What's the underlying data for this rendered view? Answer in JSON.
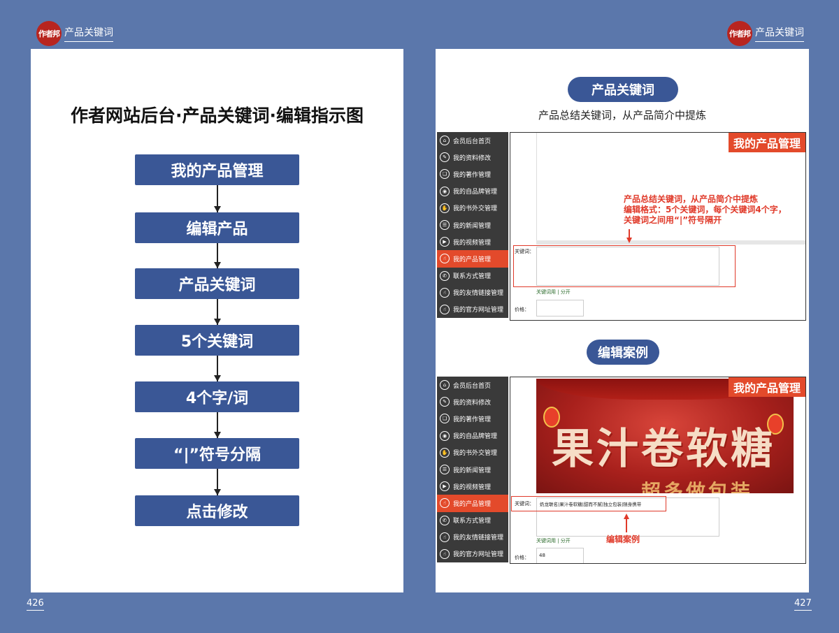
{
  "header": {
    "logo_text": "作者邦",
    "section_title": "产品关键词"
  },
  "left_page": {
    "number": "426",
    "title": "作者网站后台·产品关键词·编辑指示图",
    "flow_steps": [
      "我的产品管理",
      "编辑产品",
      "产品关键词",
      "5个关键词",
      "4个字/词",
      "“|”符号分隔",
      "点击修改"
    ]
  },
  "right_page": {
    "number": "427",
    "section1_pill": "产品关键词",
    "section1_subtitle": "产品总结关键词，从产品简介中提炼",
    "section2_pill": "编辑案例",
    "sidebar_items": [
      "会员后台首页",
      "我的资料修改",
      "我的著作管理",
      "我的自品牌管理",
      "我的书外交管理",
      "我的新闻管理",
      "我的视频管理",
      "我的产品管理",
      "联系方式管理",
      "我的友情链接管理",
      "我的官方网址管理"
    ],
    "sidebar_active": "我的产品管理",
    "panel_badge": "我的产品管理",
    "annotation_lines": [
      "产品总结关键词，从产品简介中提炼",
      "编辑格式：5个关键词，每个关键词4个字，",
      "关键词之间用“|”符号隔开"
    ],
    "keywords_label": "关键词：",
    "keywords_links": "关键词用 | 分开",
    "price_label": "价格：",
    "example_keywords": "奶龙联名|果汁卷软糖|甜而不腻|独立包装|随身携带",
    "example_price": "48",
    "example_annotation": "编辑案例",
    "banner_text": "果汁卷软糖",
    "banner_subtext": "超多做包装"
  },
  "colors": {
    "background": "#5b77ab",
    "accent_blue": "#3a5796",
    "accent_red": "#e34a2b"
  }
}
